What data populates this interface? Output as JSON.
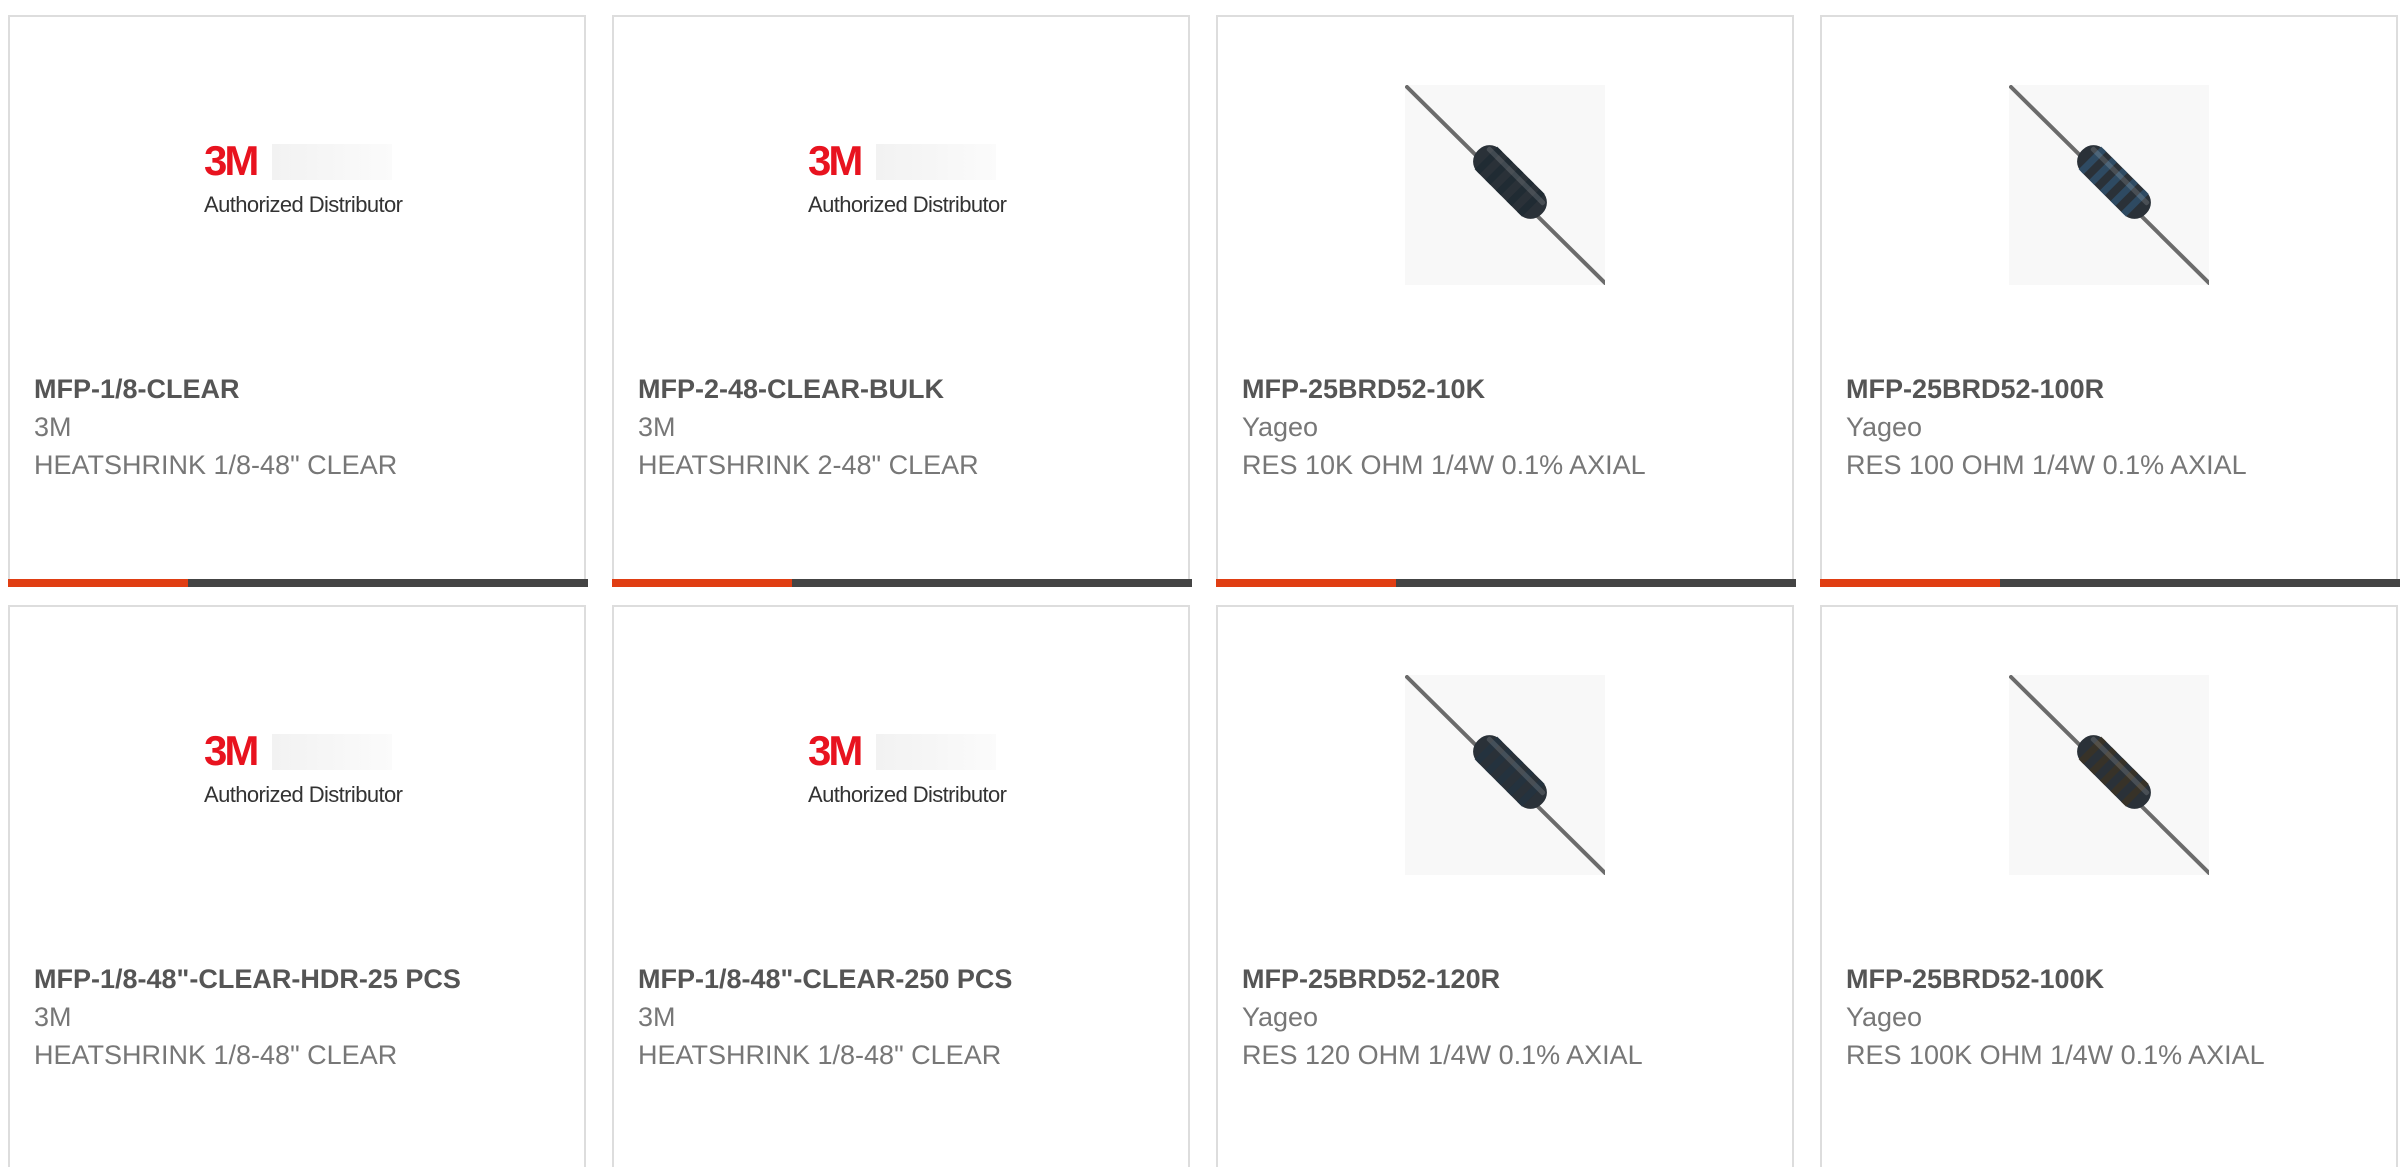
{
  "colors": {
    "accent": "#e03e13",
    "bar_dark": "#444444",
    "logo_red": "#e8131f",
    "resistor_body": "#2a3138",
    "resistor_lead": "#6b6b6b"
  },
  "products": [
    {
      "part_number": "MFP-1/8-CLEAR",
      "manufacturer": "3M",
      "description": "HEATSHRINK 1/8-48\" CLEAR",
      "image": {
        "kind": "logo-3m",
        "mark": "3M",
        "caption": "Authorized Distributor"
      },
      "bar_progress": 0.31
    },
    {
      "part_number": "MFP-2-48-CLEAR-BULK",
      "manufacturer": "3M",
      "description": "HEATSHRINK 2-48\" CLEAR",
      "image": {
        "kind": "logo-3m",
        "mark": "3M",
        "caption": "Authorized Distributor"
      },
      "bar_progress": 0.31
    },
    {
      "part_number": "MFP-25BRD52-10K",
      "manufacturer": "Yageo",
      "description": "RES 10K OHM 1/4W 0.1% AXIAL",
      "image": {
        "kind": "resistor-icon",
        "band_color": "#1f2a33"
      },
      "bar_progress": 0.31
    },
    {
      "part_number": "MFP-25BRD52-100R",
      "manufacturer": "Yageo",
      "description": "RES 100 OHM 1/4W 0.1% AXIAL",
      "image": {
        "kind": "resistor-icon",
        "band_color": "#2f4f6a"
      },
      "bar_progress": 0.31
    },
    {
      "part_number": "MFP-1/8-48\"-CLEAR-HDR-25 PCS",
      "manufacturer": "3M",
      "description": "HEATSHRINK 1/8-48\" CLEAR",
      "image": {
        "kind": "logo-3m",
        "mark": "3M",
        "caption": "Authorized Distributor"
      },
      "bar_progress": 0.31
    },
    {
      "part_number": "MFP-1/8-48\"-CLEAR-250 PCS",
      "manufacturer": "3M",
      "description": "HEATSHRINK 1/8-48\" CLEAR",
      "image": {
        "kind": "logo-3m",
        "mark": "3M",
        "caption": "Authorized Distributor"
      },
      "bar_progress": 0.31
    },
    {
      "part_number": "MFP-25BRD52-120R",
      "manufacturer": "Yageo",
      "description": "RES 120 OHM 1/4W 0.1% AXIAL",
      "image": {
        "kind": "resistor-icon",
        "band_color": "#233240"
      },
      "bar_progress": 0.31
    },
    {
      "part_number": "MFP-25BRD52-100K",
      "manufacturer": "Yageo",
      "description": "RES 100K OHM 1/4W 0.1% AXIAL",
      "image": {
        "kind": "resistor-icon",
        "band_color": "#3a3326"
      },
      "bar_progress": 0.31
    }
  ]
}
